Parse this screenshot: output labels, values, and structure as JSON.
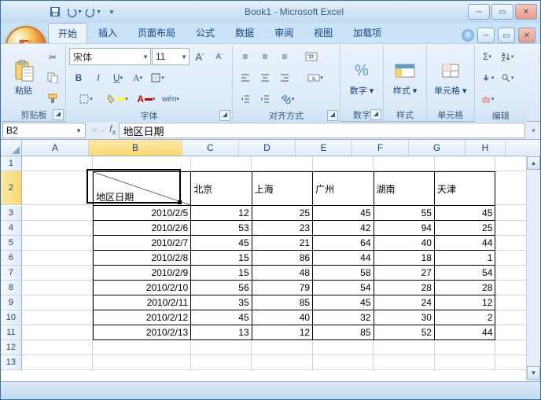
{
  "title": "Book1 - Microsoft Excel",
  "tabs": [
    "开始",
    "插入",
    "页面布局",
    "公式",
    "数据",
    "审阅",
    "视图",
    "加载项"
  ],
  "activeTab": 0,
  "font": {
    "name": "宋体",
    "size": "11"
  },
  "groups": {
    "clipboard": "剪贴板",
    "font": "字体",
    "align": "对齐方式",
    "number": "数字",
    "styles": "样式",
    "cells": "单元格",
    "editing": "编辑",
    "paste": "粘贴"
  },
  "styleBtns": {
    "number": "数字",
    "styles": "样式",
    "cells": "单元格"
  },
  "nameBox": "B2",
  "formula": "地区日期",
  "columns": [
    "A",
    "B",
    "C",
    "D",
    "E",
    "F",
    "G",
    "H"
  ],
  "headerRow": {
    "b": "地区日期",
    "c": "北京",
    "d": "上海",
    "e": "广州",
    "f": "湖南",
    "g": "天津"
  },
  "dataRows": [
    {
      "b": "2010/2/5",
      "c": "12",
      "d": "25",
      "e": "45",
      "f": "55",
      "g": "45"
    },
    {
      "b": "2010/2/6",
      "c": "53",
      "d": "23",
      "e": "42",
      "f": "94",
      "g": "25"
    },
    {
      "b": "2010/2/7",
      "c": "45",
      "d": "21",
      "e": "64",
      "f": "40",
      "g": "44"
    },
    {
      "b": "2010/2/8",
      "c": "15",
      "d": "86",
      "e": "44",
      "f": "18",
      "g": "1"
    },
    {
      "b": "2010/2/9",
      "c": "15",
      "d": "48",
      "e": "58",
      "f": "27",
      "g": "54"
    },
    {
      "b": "2010/2/10",
      "c": "56",
      "d": "79",
      "e": "54",
      "f": "28",
      "g": "28"
    },
    {
      "b": "2010/2/11",
      "c": "35",
      "d": "85",
      "e": "45",
      "f": "24",
      "g": "12"
    },
    {
      "b": "2010/2/12",
      "c": "45",
      "d": "40",
      "e": "32",
      "f": "30",
      "g": "2"
    },
    {
      "b": "2010/2/13",
      "c": "13",
      "d": "12",
      "e": "85",
      "f": "52",
      "g": "44"
    }
  ]
}
